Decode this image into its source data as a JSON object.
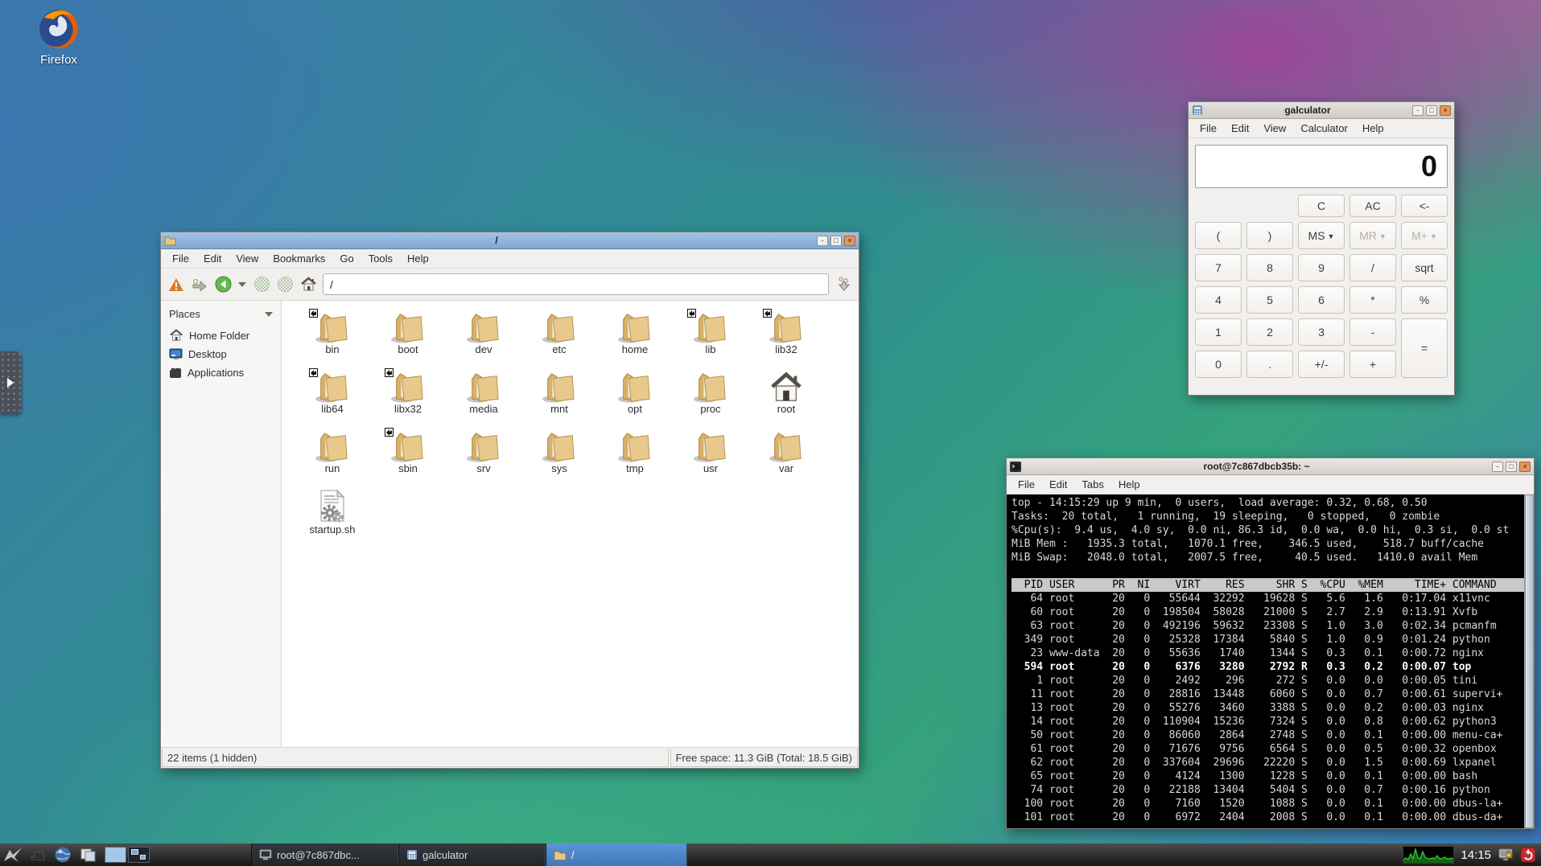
{
  "desktop": {
    "firefox_label": "Firefox"
  },
  "window_controls": {
    "minimize": "-",
    "maximize": "□",
    "close": "×"
  },
  "file_manager": {
    "title": "/",
    "menu": [
      "File",
      "Edit",
      "View",
      "Bookmarks",
      "Go",
      "Tools",
      "Help"
    ],
    "toolbar_icons": [
      "warning",
      "new-tab",
      "back",
      "chevron-down",
      "forward",
      "up",
      "home"
    ],
    "path": "/",
    "sidebar": {
      "header": "Places",
      "items": [
        {
          "label": "Home Folder",
          "icon": "home"
        },
        {
          "label": "Desktop",
          "icon": "desktop"
        },
        {
          "label": "Applications",
          "icon": "applications"
        }
      ]
    },
    "files": [
      {
        "name": "bin",
        "icon": "folder",
        "symlink": true
      },
      {
        "name": "boot",
        "icon": "folder"
      },
      {
        "name": "dev",
        "icon": "folder"
      },
      {
        "name": "etc",
        "icon": "folder"
      },
      {
        "name": "home",
        "icon": "folder"
      },
      {
        "name": "lib",
        "icon": "folder",
        "symlink": true
      },
      {
        "name": "lib32",
        "icon": "folder",
        "symlink": true
      },
      {
        "name": "lib64",
        "icon": "folder",
        "symlink": true
      },
      {
        "name": "libx32",
        "icon": "folder",
        "symlink": true
      },
      {
        "name": "media",
        "icon": "folder"
      },
      {
        "name": "mnt",
        "icon": "folder"
      },
      {
        "name": "opt",
        "icon": "folder"
      },
      {
        "name": "proc",
        "icon": "folder"
      },
      {
        "name": "root",
        "icon": "home-dir"
      },
      {
        "name": "run",
        "icon": "folder"
      },
      {
        "name": "sbin",
        "icon": "folder",
        "symlink": true
      },
      {
        "name": "srv",
        "icon": "folder"
      },
      {
        "name": "sys",
        "icon": "folder"
      },
      {
        "name": "tmp",
        "icon": "folder"
      },
      {
        "name": "usr",
        "icon": "folder"
      },
      {
        "name": "var",
        "icon": "folder"
      },
      {
        "name": "startup.sh",
        "icon": "script"
      }
    ],
    "status_left": "22 items (1 hidden)",
    "status_right": "Free space: 11.3 GiB (Total: 18.5 GiB)"
  },
  "calculator": {
    "title": "galculator",
    "menu": [
      "File",
      "Edit",
      "View",
      "Calculator",
      "Help"
    ],
    "display": "0",
    "keys": [
      {
        "label": "C",
        "col": 3,
        "row": 1
      },
      {
        "label": "AC",
        "col": 4,
        "row": 1
      },
      {
        "label": "<-",
        "col": 5,
        "row": 1
      },
      {
        "label": "(",
        "col": 1,
        "row": 2
      },
      {
        "label": ")",
        "col": 2,
        "row": 2
      },
      {
        "label": "MS",
        "col": 3,
        "row": 2,
        "dropdown": true
      },
      {
        "label": "MR",
        "col": 4,
        "row": 2,
        "dropdown": true,
        "disabled": true
      },
      {
        "label": "M+",
        "col": 5,
        "row": 2,
        "dropdown": true,
        "disabled": true
      },
      {
        "label": "7",
        "col": 1,
        "row": 3
      },
      {
        "label": "8",
        "col": 2,
        "row": 3
      },
      {
        "label": "9",
        "col": 3,
        "row": 3
      },
      {
        "label": "/",
        "col": 4,
        "row": 3
      },
      {
        "label": "sqrt",
        "col": 5,
        "row": 3
      },
      {
        "label": "4",
        "col": 1,
        "row": 4
      },
      {
        "label": "5",
        "col": 2,
        "row": 4
      },
      {
        "label": "6",
        "col": 3,
        "row": 4
      },
      {
        "label": "*",
        "col": 4,
        "row": 4
      },
      {
        "label": "%",
        "col": 5,
        "row": 4
      },
      {
        "label": "1",
        "col": 1,
        "row": 5
      },
      {
        "label": "2",
        "col": 2,
        "row": 5
      },
      {
        "label": "3",
        "col": 3,
        "row": 5
      },
      {
        "label": "-",
        "col": 4,
        "row": 5
      },
      {
        "label": "=",
        "col": 5,
        "row": 5,
        "rowspan": 2
      },
      {
        "label": "0",
        "col": 1,
        "row": 6
      },
      {
        "label": ".",
        "col": 2,
        "row": 6
      },
      {
        "label": "+/-",
        "col": 3,
        "row": 6
      },
      {
        "label": "+",
        "col": 4,
        "row": 6
      }
    ]
  },
  "terminal": {
    "title": "root@7c867dbcb35b: ~",
    "menu": [
      "File",
      "Edit",
      "Tabs",
      "Help"
    ],
    "summary": [
      "top - 14:15:29 up 9 min,  0 users,  load average: 0.32, 0.68, 0.50",
      "Tasks:  20 total,   1 running,  19 sleeping,   0 stopped,   0 zombie",
      "%Cpu(s):  9.4 us,  4.0 sy,  0.0 ni, 86.3 id,  0.0 wa,  0.0 hi,  0.3 si,  0.0 st",
      "MiB Mem :   1935.3 total,   1070.1 free,    346.5 used,    518.7 buff/cache",
      "MiB Swap:   2048.0 total,   2007.5 free,     40.5 used.   1410.0 avail Mem"
    ],
    "table": {
      "header": [
        "PID",
        "USER",
        "PR",
        "NI",
        "VIRT",
        "RES",
        "SHR",
        "S",
        "%CPU",
        "%MEM",
        "TIME+",
        "COMMAND"
      ],
      "highlight_index": 5,
      "rows": [
        [
          "64",
          "root",
          "20",
          "0",
          "55644",
          "32292",
          "19628",
          "S",
          "5.6",
          "1.6",
          "0:17.04",
          "x11vnc"
        ],
        [
          "60",
          "root",
          "20",
          "0",
          "198504",
          "58028",
          "21000",
          "S",
          "2.7",
          "2.9",
          "0:13.91",
          "Xvfb"
        ],
        [
          "63",
          "root",
          "20",
          "0",
          "492196",
          "59632",
          "23308",
          "S",
          "1.0",
          "3.0",
          "0:02.34",
          "pcmanfm"
        ],
        [
          "349",
          "root",
          "20",
          "0",
          "25328",
          "17384",
          "5840",
          "S",
          "1.0",
          "0.9",
          "0:01.24",
          "python"
        ],
        [
          "23",
          "www-data",
          "20",
          "0",
          "55636",
          "1740",
          "1344",
          "S",
          "0.3",
          "0.1",
          "0:00.72",
          "nginx"
        ],
        [
          "594",
          "root",
          "20",
          "0",
          "6376",
          "3280",
          "2792",
          "R",
          "0.3",
          "0.2",
          "0:00.07",
          "top"
        ],
        [
          "1",
          "root",
          "20",
          "0",
          "2492",
          "296",
          "272",
          "S",
          "0.0",
          "0.0",
          "0:00.05",
          "tini"
        ],
        [
          "11",
          "root",
          "20",
          "0",
          "28816",
          "13448",
          "6060",
          "S",
          "0.0",
          "0.7",
          "0:00.61",
          "supervi+"
        ],
        [
          "13",
          "root",
          "20",
          "0",
          "55276",
          "3460",
          "3388",
          "S",
          "0.0",
          "0.2",
          "0:00.03",
          "nginx"
        ],
        [
          "14",
          "root",
          "20",
          "0",
          "110904",
          "15236",
          "7324",
          "S",
          "0.0",
          "0.8",
          "0:00.62",
          "python3"
        ],
        [
          "50",
          "root",
          "20",
          "0",
          "86060",
          "2864",
          "2748",
          "S",
          "0.0",
          "0.1",
          "0:00.00",
          "menu-ca+"
        ],
        [
          "61",
          "root",
          "20",
          "0",
          "71676",
          "9756",
          "6564",
          "S",
          "0.0",
          "0.5",
          "0:00.32",
          "openbox"
        ],
        [
          "62",
          "root",
          "20",
          "0",
          "337604",
          "29696",
          "22220",
          "S",
          "0.0",
          "1.5",
          "0:00.69",
          "lxpanel"
        ],
        [
          "65",
          "root",
          "20",
          "0",
          "4124",
          "1300",
          "1228",
          "S",
          "0.0",
          "0.1",
          "0:00.00",
          "bash"
        ],
        [
          "74",
          "root",
          "20",
          "0",
          "22188",
          "13404",
          "5404",
          "S",
          "0.0",
          "0.7",
          "0:00.16",
          "python"
        ],
        [
          "100",
          "root",
          "20",
          "0",
          "7160",
          "1520",
          "1088",
          "S",
          "0.0",
          "0.1",
          "0:00.00",
          "dbus-la+"
        ],
        [
          "101",
          "root",
          "20",
          "0",
          "6972",
          "2404",
          "2008",
          "S",
          "0.0",
          "0.1",
          "0:00.00",
          "dbus-da+"
        ]
      ]
    }
  },
  "taskbar": {
    "launcher_icons": [
      "lxde-menu",
      "minimize-all",
      "web-browser",
      "file-manager"
    ],
    "tasks": [
      {
        "label": "root@7c867dbc...",
        "icon": "terminal",
        "active": false
      },
      {
        "label": "galculator",
        "icon": "calculator",
        "active": false
      },
      {
        "label": "/",
        "icon": "folder",
        "active": true
      }
    ],
    "tray_icons": [
      "cpu-monitor",
      "lock-screen",
      "power"
    ],
    "clock": "14:15"
  },
  "colors": {
    "task_active": "#4f86c6",
    "folder": "#e8c687",
    "terminal_green": "#33cc33",
    "titlebar_blue": "#7ea9d2"
  }
}
